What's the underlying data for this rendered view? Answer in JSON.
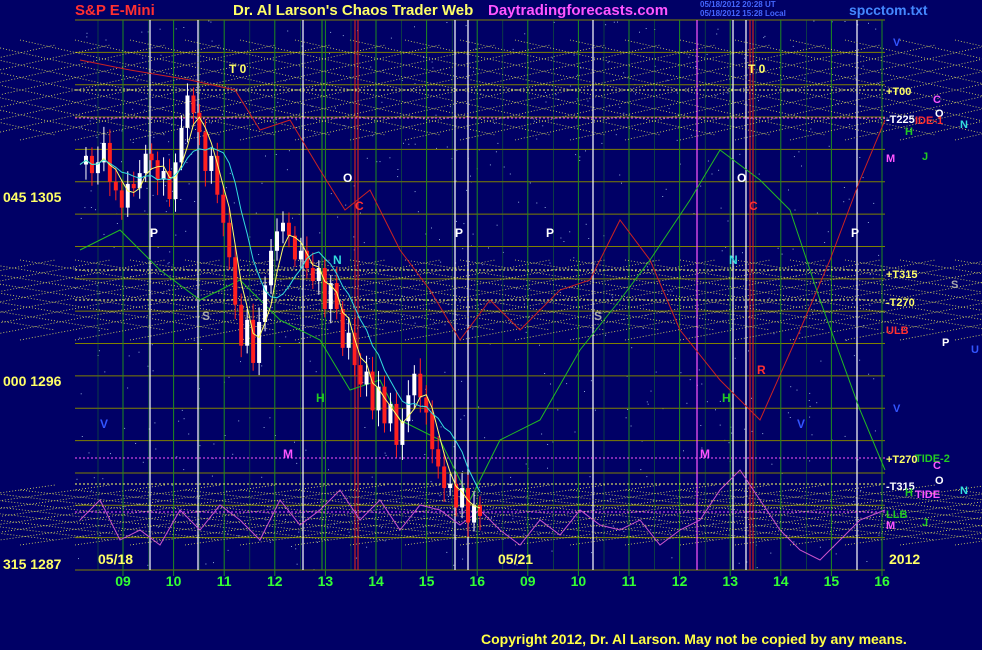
{
  "header": {
    "instrument": "S&P E-Mini",
    "site_title": "Dr. Al Larson's Chaos Trader Web",
    "site_url": "Daytradingforecasts.com",
    "stamp_line1": "05/18/2012 20:28 UT",
    "stamp_line2": "05/18/2012 15:28 Local",
    "file_name": "spcctom.txt"
  },
  "footer": {
    "copyright": "Copyright 2012, Dr. Al Larson. May not be copied by any means."
  },
  "colors": {
    "background": "#000066",
    "grid": "#808000",
    "grid_vertical": "#1e8c1e",
    "price_up": "#ffffff",
    "price_down": "#ff2020",
    "ma_fast": "#ffff66",
    "ma_slow": "#33dddd",
    "red_curve": "#cc2222",
    "green_curve": "#22bb22",
    "magenta_curve": "#cc55cc"
  },
  "chart_data": {
    "type": "candlestick",
    "y_axis_labels": [
      {
        "deg": "045",
        "price": "1305"
      },
      {
        "deg": "000",
        "price": "1296"
      },
      {
        "deg": "315",
        "price": "1287"
      }
    ],
    "ylim": [
      1287,
      1312.5
    ],
    "x_date_labels": [
      "05/18",
      "05/21"
    ],
    "year_label": "2012",
    "x_hour_ticks": [
      "09",
      "10",
      "11",
      "12",
      "13",
      "14",
      "15",
      "16",
      "09",
      "10",
      "11",
      "12",
      "13",
      "14",
      "15",
      "16"
    ],
    "right_level_labels": [
      "+T00",
      "-T225",
      "M",
      "+T315",
      "-T270",
      "ULB",
      "V",
      "+T270",
      "-T315",
      "LLB",
      "M"
    ],
    "right_markers": [
      "C",
      "O",
      "IDE-1",
      "H",
      "J",
      "N",
      "S",
      "P",
      "U",
      "TIDE-2",
      "C",
      "O",
      "TIDE",
      "H",
      "N",
      "J"
    ],
    "top_markers": [
      "T 0",
      "T 0"
    ],
    "planet_markers": [
      "P",
      "S",
      "O",
      "C",
      "N",
      "H",
      "M",
      "V",
      "P",
      "P",
      "S",
      "O",
      "C",
      "N",
      "R",
      "H",
      "M",
      "V",
      "P"
    ],
    "price_series": [
      1305.8,
      1306.2,
      1305.4,
      1305.9,
      1306.8,
      1305.0,
      1304.6,
      1303.8,
      1304.9,
      1304.7,
      1305.4,
      1306.3,
      1306.0,
      1305.1,
      1305.5,
      1304.2,
      1305.9,
      1307.5,
      1309.0,
      1308.2,
      1307.3,
      1305.5,
      1306.2,
      1304.4,
      1303.1,
      1301.5,
      1299.3,
      1297.4,
      1298.6,
      1296.6,
      1298.5,
      1300.2,
      1301.8,
      1302.7,
      1303.1,
      1302.5,
      1301.4,
      1301.8,
      1301.0,
      1300.4,
      1301.0,
      1299.1,
      1300.3,
      1299.1,
      1297.3,
      1298.0,
      1296.5,
      1295.6,
      1296.2,
      1294.4,
      1295.5,
      1293.8,
      1294.7,
      1292.8,
      1293.9,
      1295.1,
      1296.1,
      1295.0,
      1294.3,
      1292.6,
      1291.8,
      1290.8,
      1291.0,
      1289.9,
      1290.8,
      1289.2,
      1290.0,
      1289.5
    ]
  }
}
